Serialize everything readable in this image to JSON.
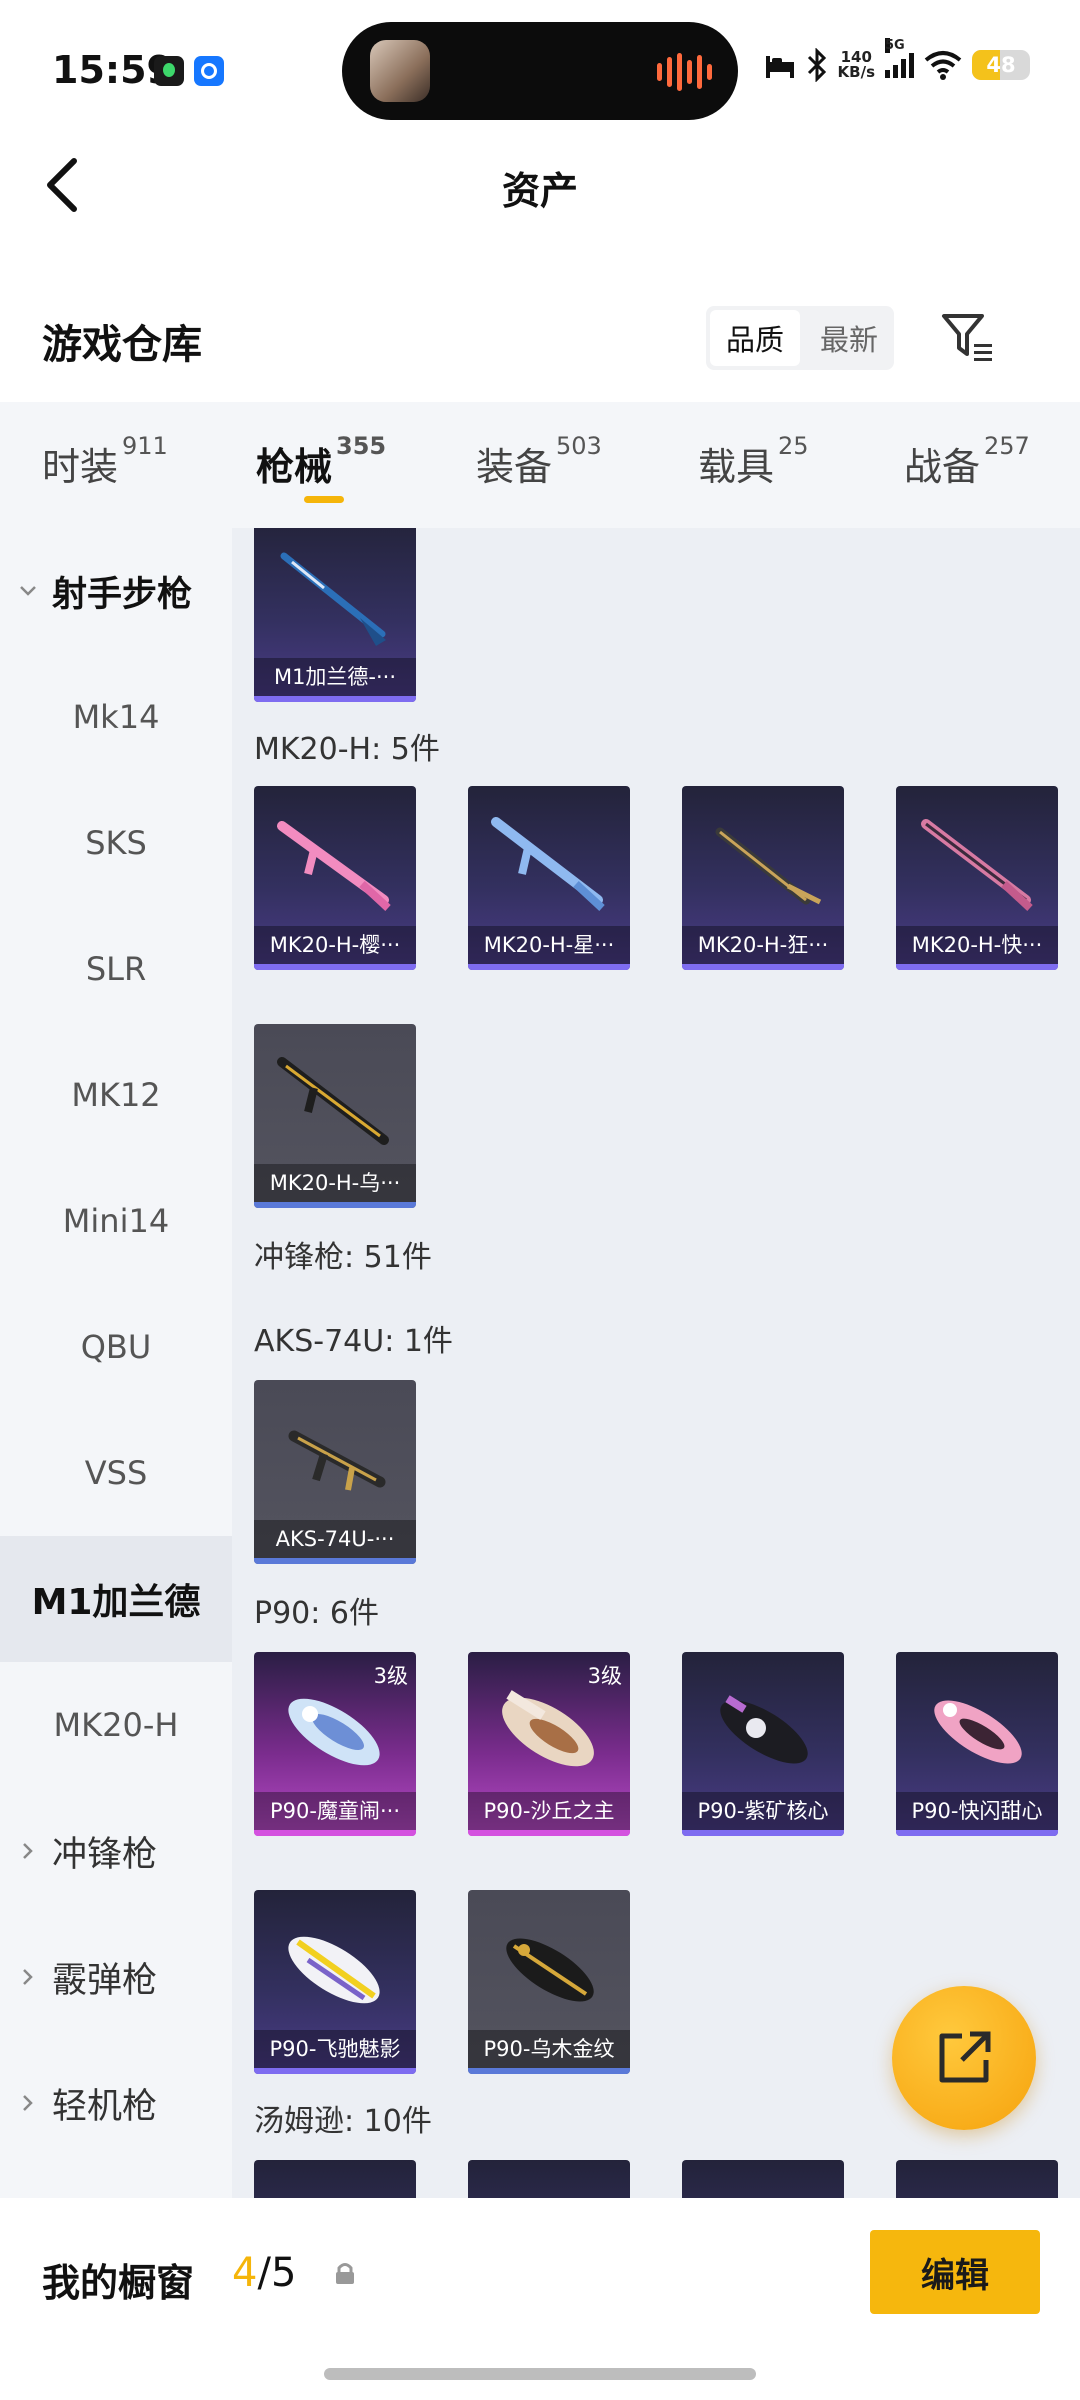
{
  "status": {
    "time": "15:59",
    "speed_value": "140",
    "speed_unit": "KB/s",
    "network": "5G",
    "battery": "48",
    "battery_level": 0.48
  },
  "header": {
    "title": "资产"
  },
  "warehouse": {
    "title": "游戏仓库",
    "sort_quality": "品质",
    "sort_latest": "最新"
  },
  "tabs": [
    {
      "label": "时装",
      "count": "911"
    },
    {
      "label": "枪械",
      "count": "355"
    },
    {
      "label": "装备",
      "count": "503"
    },
    {
      "label": "载具",
      "count": "25"
    },
    {
      "label": "战备",
      "count": "257"
    }
  ],
  "sidebar": {
    "items": [
      {
        "label": "射手步枪"
      },
      {
        "label": "Mk14"
      },
      {
        "label": "SKS"
      },
      {
        "label": "SLR"
      },
      {
        "label": "MK12"
      },
      {
        "label": "Mini14"
      },
      {
        "label": "QBU"
      },
      {
        "label": "VSS"
      },
      {
        "label": "M1加兰德"
      },
      {
        "label": "MK20-H"
      },
      {
        "label": "冲锋枪"
      },
      {
        "label": "霰弹枪"
      },
      {
        "label": "轻机枪"
      }
    ]
  },
  "content": {
    "sections": [
      {
        "title": "MK20-H: 5件"
      },
      {
        "title": "冲锋枪: 51件"
      },
      {
        "title": "AKS-74U: 1件"
      },
      {
        "title": "P90: 6件"
      },
      {
        "title": "汤姆逊: 10件"
      }
    ],
    "items": [
      {
        "label": "M1加兰德-···"
      },
      {
        "label": "MK20-H-樱···"
      },
      {
        "label": "MK20-H-星···"
      },
      {
        "label": "MK20-H-狂···"
      },
      {
        "label": "MK20-H-快···"
      },
      {
        "label": "MK20-H-乌···"
      },
      {
        "label": "AKS-74U-···"
      },
      {
        "label": "P90-魔童闹···",
        "level": "3级"
      },
      {
        "label": "P90-沙丘之主",
        "level": "3级"
      },
      {
        "label": "P90-紫矿核心"
      },
      {
        "label": "P90-快闪甜心"
      },
      {
        "label": "P90-飞驰魅影"
      },
      {
        "label": "P90-乌木金纹"
      }
    ]
  },
  "showcase": {
    "label": "我的橱窗",
    "current": "4",
    "separator": "/",
    "total": "5",
    "edit_label": "编辑"
  },
  "colors": {
    "accent": "#f6b70d",
    "card_purple": "#4b3c88",
    "card_pink": "#b84bc8",
    "card_gray": "#54545f"
  }
}
